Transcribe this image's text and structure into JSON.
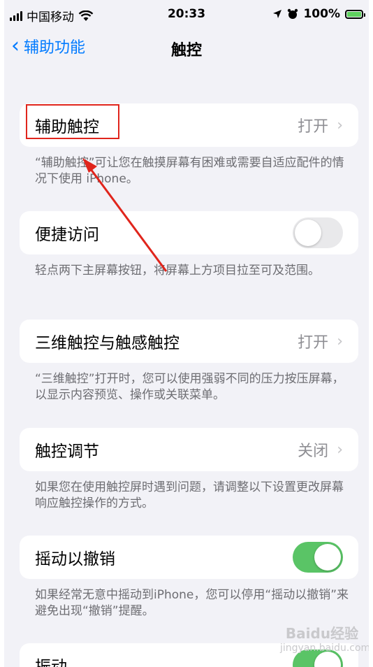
{
  "status_bar": {
    "carrier": "中国移动",
    "time": "20:33",
    "battery": "100%"
  },
  "nav": {
    "back_label": "辅助功能",
    "title": "触控"
  },
  "sections": [
    {
      "label": "辅助触控",
      "value": "打开",
      "footer": "“辅助触控”可让您在触摸屏幕有困难或需要自适应配件的情况下使用 iPhone。"
    },
    {
      "label": "便捷访问",
      "toggle": "off",
      "footer": "轻点两下主屏幕按钮，将屏幕上方项目拉至可及范围。"
    },
    {
      "label": "三维触控与触感触控",
      "value": "打开",
      "footer": "“三维触控”打开时，您可以使用强弱不同的压力按压屏幕，以显示内容预览、操作或关联菜单。"
    },
    {
      "label": "触控调节",
      "value": "关闭",
      "footer": "如果您在使用触控屏时遇到问题，请调整以下设置更改屏幕响应触控操作的方式。"
    },
    {
      "label": "摇动以撤销",
      "toggle": "on",
      "footer": "如果经常无意中摇动到iPhone，您可以停用“摇动以撤销”来避免出现“撤销”提醒。"
    },
    {
      "label": "振动",
      "toggle": "on"
    }
  ],
  "watermark": {
    "line1": "Baidu经验",
    "line2": "jingyan.baidu.com"
  },
  "colors": {
    "accent": "#007aff",
    "toggle_on": "#5ac466",
    "annotation": "#e0251c"
  }
}
